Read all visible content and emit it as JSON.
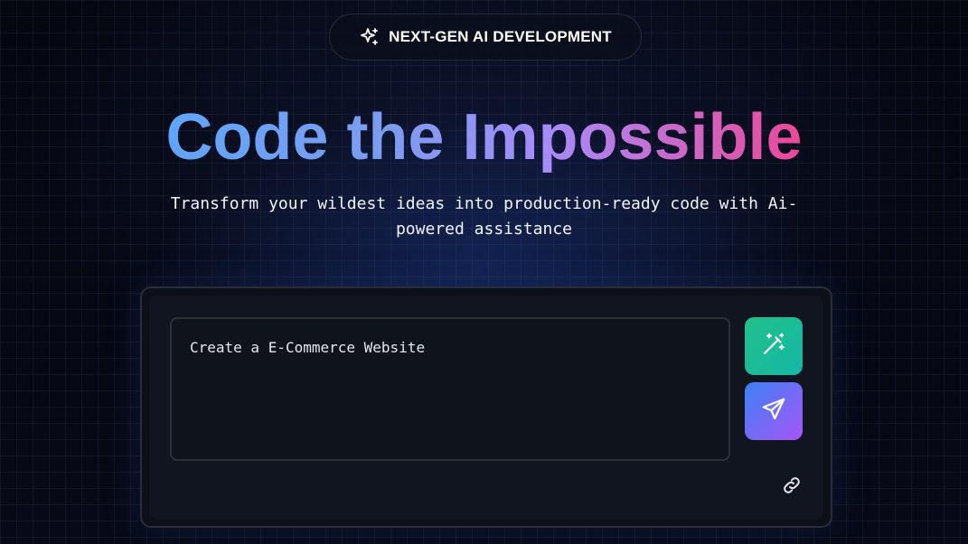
{
  "badge": {
    "icon": "sparkles-icon",
    "label": "NEXT-GEN AI DEVELOPMENT"
  },
  "hero": {
    "title": "Code the Impossible",
    "subtitle": "Transform your wildest ideas into production-ready code with Ai-powered assistance"
  },
  "prompt": {
    "value": "Create a E-Commerce Website"
  },
  "actions": {
    "enhance_icon": "magic-wand-icon",
    "send_icon": "send-icon",
    "link_icon": "link-icon"
  },
  "colors": {
    "gradient_start": "#60a5fa",
    "gradient_mid": "#a78bfa",
    "gradient_end": "#ec4899",
    "enhance_button": "#14b8a6",
    "send_button_start": "#3b82f6",
    "send_button_end": "#a855f7"
  }
}
